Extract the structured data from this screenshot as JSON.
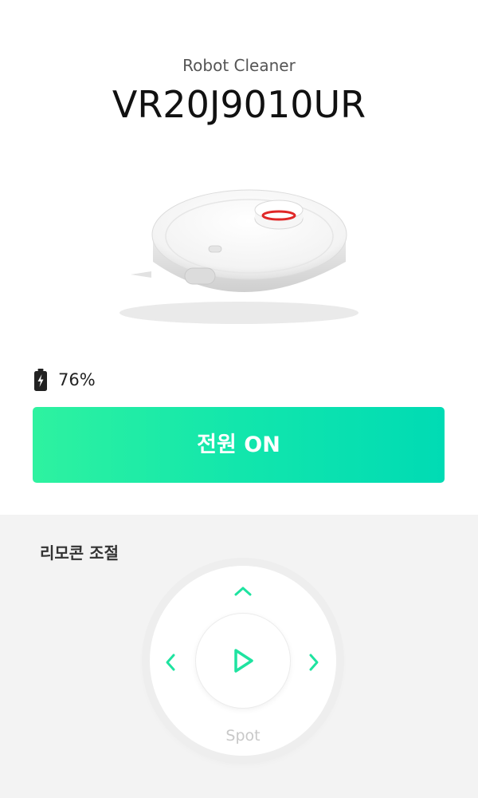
{
  "header": {
    "subtitle": "Robot Cleaner",
    "model": "VR20J9010UR"
  },
  "product": {
    "image": "robot-vacuum"
  },
  "battery": {
    "icon": "battery-charging-icon",
    "level_text": "76%",
    "level": 0.76
  },
  "power": {
    "label": "전원 ON"
  },
  "remote": {
    "title": "리모콘 조절",
    "spot_label": "Spot",
    "icons": [
      "chevron-up-icon",
      "chevron-left-icon",
      "chevron-right-icon",
      "play-icon"
    ]
  },
  "colors": {
    "accent_start": "#2ef2a0",
    "accent_end": "#00dbb4",
    "icon_accent": "#1ee3a0"
  }
}
